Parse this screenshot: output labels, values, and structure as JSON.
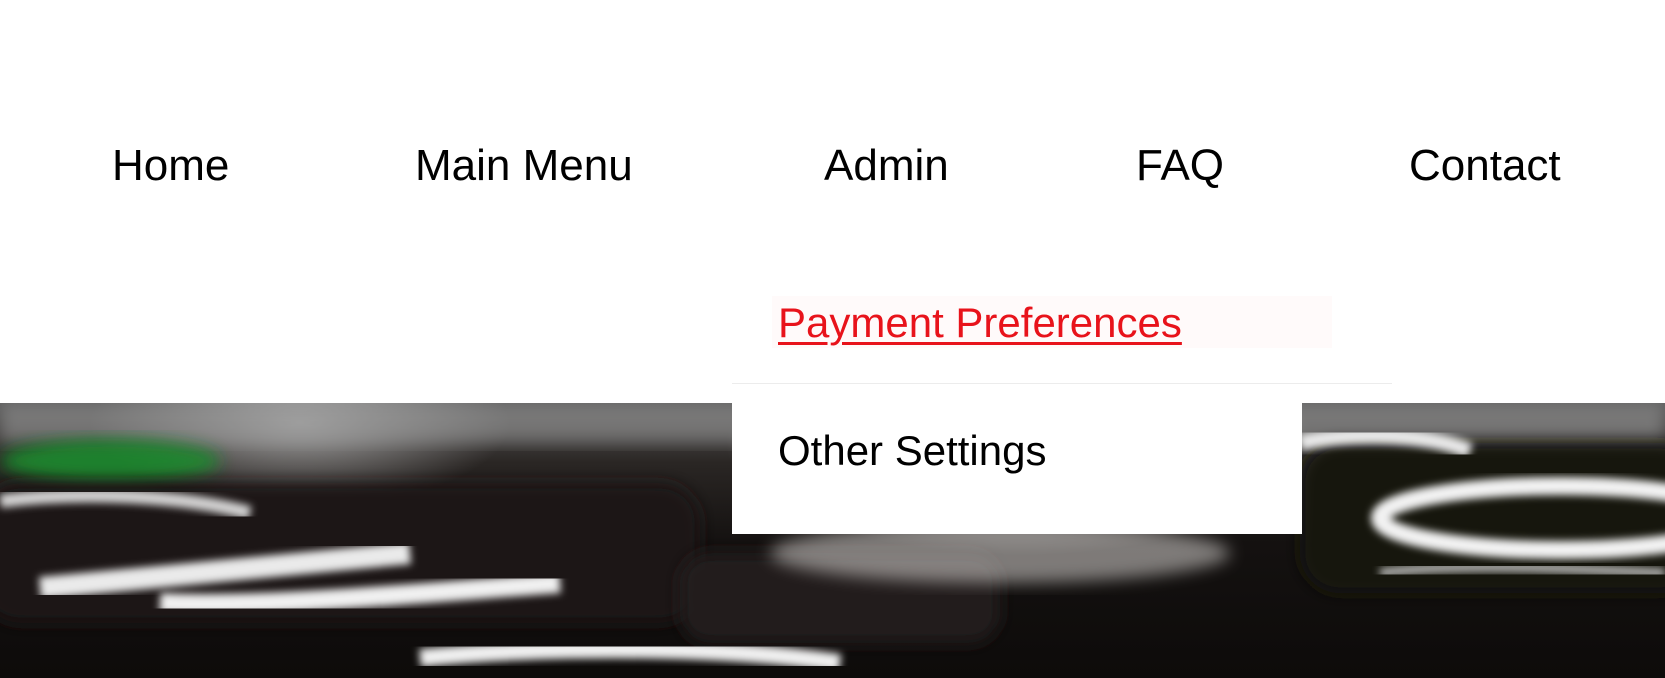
{
  "nav": {
    "items": [
      {
        "label": "Home"
      },
      {
        "label": "Main Menu"
      },
      {
        "label": "Admin"
      },
      {
        "label": "FAQ"
      },
      {
        "label": "Contact"
      }
    ]
  },
  "admin_dropdown": {
    "items": [
      {
        "label": "Payment Preferences",
        "state": "hover",
        "color": "#e8131b"
      },
      {
        "label": "Other Settings"
      }
    ]
  },
  "hero": {
    "image": "blurred-keyboard-photo"
  },
  "colors": {
    "background": "#ffffff",
    "text": "#000000",
    "accent": "#e8131b"
  }
}
